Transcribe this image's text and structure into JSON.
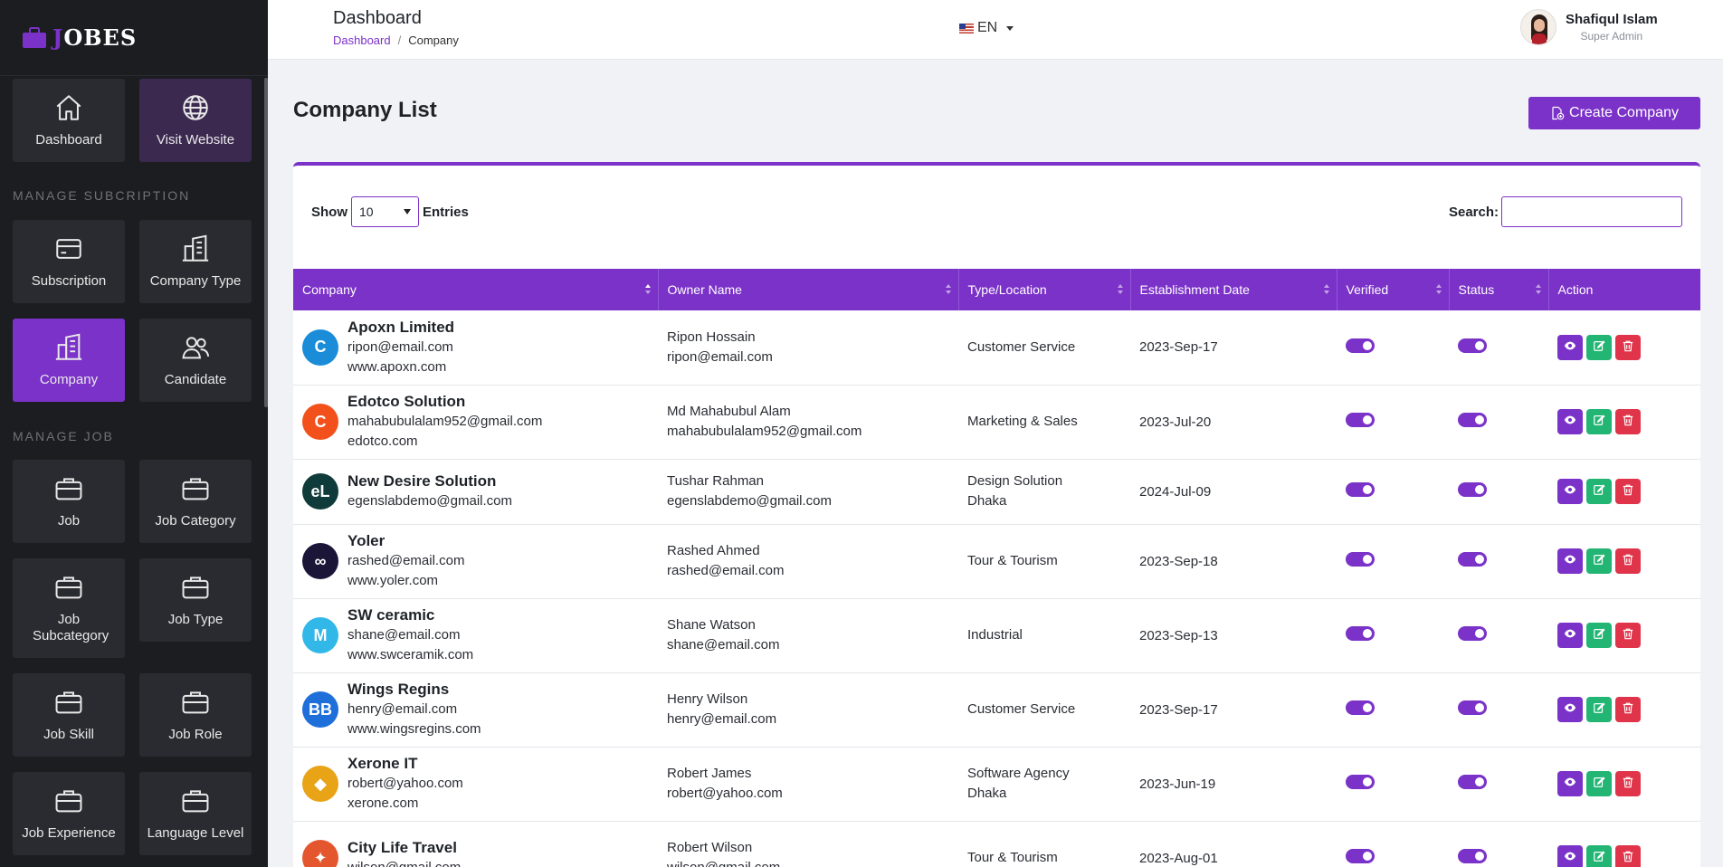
{
  "brand": {
    "name_first": "J",
    "name_rest": "OBES"
  },
  "sidebar": {
    "top_tiles": [
      {
        "label": "Dashboard",
        "icon": "home-icon"
      },
      {
        "label": "Visit Website",
        "icon": "globe-icon"
      }
    ],
    "sections": [
      {
        "title": "MANAGE SUBCRIPTION",
        "tiles": [
          {
            "label": "Subscription",
            "icon": "card-icon"
          },
          {
            "label": "Company Type",
            "icon": "building-icon"
          },
          {
            "label": "Company",
            "icon": "building-icon"
          },
          {
            "label": "Candidate",
            "icon": "users-icon"
          }
        ]
      },
      {
        "title": "MANAGE JOB",
        "tiles": [
          {
            "label": "Job",
            "icon": "briefcase-icon"
          },
          {
            "label": "Job Category",
            "icon": "briefcase-icon"
          },
          {
            "label": "Job Subcategory",
            "icon": "briefcase-icon"
          },
          {
            "label": "Job Type",
            "icon": "briefcase-icon"
          },
          {
            "label": "Job Skill",
            "icon": "briefcase-icon"
          },
          {
            "label": "Job Role",
            "icon": "briefcase-icon"
          },
          {
            "label": "Job Experience",
            "icon": "briefcase-icon"
          },
          {
            "label": "Language Level",
            "icon": "briefcase-icon"
          }
        ]
      }
    ]
  },
  "header": {
    "title": "Dashboard",
    "breadcrumb": {
      "home": "Dashboard",
      "separator": "/",
      "current": "Company"
    },
    "language": "EN",
    "user": {
      "name": "Shafiqul Islam",
      "role": "Super Admin"
    }
  },
  "main": {
    "title": "Company List",
    "create_label": "Create Company",
    "show_label": "Show",
    "entries_value": "10",
    "entries_label": "Entries",
    "search_label": "Search:",
    "search_value": ""
  },
  "table": {
    "columns": [
      "Company",
      "Owner Name",
      "Type/Location",
      "Establishment Date",
      "Verified",
      "Status",
      "Action"
    ],
    "rows": [
      {
        "name": "Apoxn Limited",
        "email": "ripon@email.com",
        "website": "www.apoxn.com",
        "owner": "Ripon Hossain",
        "owner_email": "ripon@email.com",
        "type": "Customer Service",
        "location": "",
        "date": "2023-Sep-17",
        "verified": true,
        "status": true,
        "logo_color": "#1a8cd8",
        "logo_text": "C"
      },
      {
        "name": "Edotco Solution",
        "email": "mahabubulalam952@gmail.com",
        "website": "edotco.com",
        "owner": "Md Mahabubul Alam",
        "owner_email": "mahabubulalam952@gmail.com",
        "type": "Marketing & Sales",
        "location": "",
        "date": "2023-Jul-20",
        "verified": true,
        "status": true,
        "logo_color": "#f2511b",
        "logo_text": "C"
      },
      {
        "name": "New Desire Solution",
        "email": "egenslabdemo@gmail.com",
        "website": "",
        "owner": "Tushar Rahman",
        "owner_email": "egenslabdemo@gmail.com",
        "type": "Design Solution",
        "location": "Dhaka",
        "date": "2024-Jul-09",
        "verified": true,
        "status": true,
        "logo_color": "#0f3b3a",
        "logo_text": "eL"
      },
      {
        "name": "Yoler",
        "email": "rashed@email.com",
        "website": "www.yoler.com",
        "owner": "Rashed Ahmed",
        "owner_email": "rashed@email.com",
        "type": "Tour & Tourism",
        "location": "",
        "date": "2023-Sep-18",
        "verified": true,
        "status": true,
        "logo_color": "#1b1538",
        "logo_text": "∞"
      },
      {
        "name": "SW ceramic",
        "email": "shane@email.com",
        "website": "www.swceramik.com",
        "owner": "Shane Watson",
        "owner_email": "shane@email.com",
        "type": "Industrial",
        "location": "",
        "date": "2023-Sep-13",
        "verified": true,
        "status": true,
        "logo_color": "#32b8e8",
        "logo_text": "M"
      },
      {
        "name": "Wings Regins",
        "email": "henry@email.com",
        "website": "www.wingsregins.com",
        "owner": "Henry Wilson",
        "owner_email": "henry@email.com",
        "type": "Customer Service",
        "location": "",
        "date": "2023-Sep-17",
        "verified": true,
        "status": true,
        "logo_color": "#1e6fd9",
        "logo_text": "BB"
      },
      {
        "name": "Xerone IT",
        "email": "robert@yahoo.com",
        "website": "xerone.com",
        "owner": "Robert James",
        "owner_email": "robert@yahoo.com",
        "type": "Software Agency",
        "location": "Dhaka",
        "date": "2023-Jun-19",
        "verified": true,
        "status": true,
        "logo_color": "#e8a317",
        "logo_text": "◆"
      },
      {
        "name": "City Life Travel",
        "email": "wilson@gmail.com",
        "website": "",
        "owner": "Robert Wilson",
        "owner_email": "wilson@gmail.com",
        "type": "Tour & Tourism",
        "location": "",
        "date": "2023-Aug-01",
        "verified": true,
        "status": true,
        "logo_color": "#e4572e",
        "logo_text": "✦"
      }
    ]
  },
  "colors": {
    "accent": "#7b32c8",
    "edit": "#22b573",
    "delete": "#e0344a",
    "sidebar_bg": "#1c1d21"
  }
}
